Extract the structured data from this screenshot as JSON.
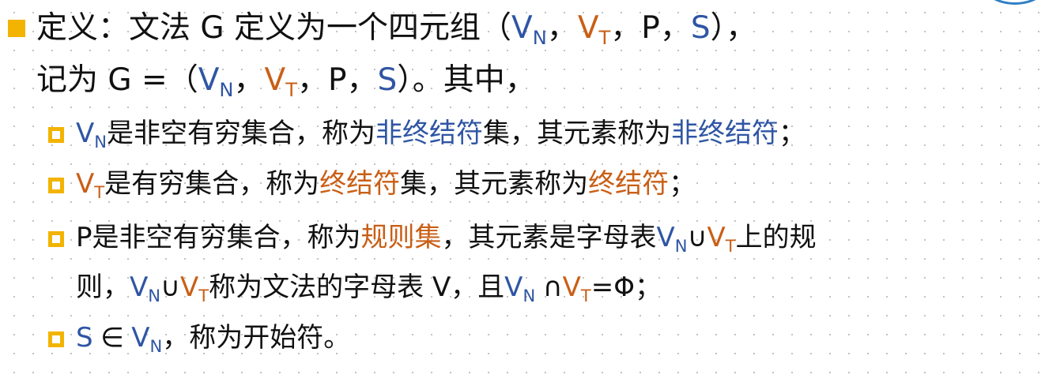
{
  "colors": {
    "background": "#ffffff",
    "bullet": "#f2b400",
    "text": "#111111",
    "blue": "#2f55a4",
    "orange": "#c95f16",
    "circle": "#2f7fc4"
  },
  "icons": {
    "main_bullet": "filled-square",
    "sub_bullet": "hollow-square",
    "corner_shape": "partial-circle"
  },
  "lines": {
    "line1": {
      "definition_label": "定义：文法 G 定义为一个四元组（",
      "vn": "V",
      "vn_sub": "N",
      "comma1": "，",
      "vt": "V",
      "vt_sub": "T",
      "comma2": "，",
      "p": "P",
      "comma3": "，",
      "s": "S",
      "close": "），"
    },
    "line2": {
      "prefix": "记为 G =（",
      "vn": "V",
      "vn_sub": "N",
      "comma1": "，",
      "vt": "V",
      "vt_sub": "T",
      "comma2": "，",
      "p": "P",
      "comma3": "，",
      "s": "S",
      "suffix": "）。其中，"
    },
    "line3": {
      "v": "V",
      "sub": "N",
      "text1": "是非空有穷集合，称为",
      "highlight1": "非终结符",
      "text2": "集，其元素称为",
      "highlight2": "非终结符",
      "text3": "；"
    },
    "line4": {
      "v": "V",
      "sub": "T",
      "text1": "是有穷集合，称为",
      "highlight1": "终结符",
      "text2": "集，其元素称为",
      "highlight2": "终结符",
      "text3": "；"
    },
    "line5": {
      "p": "P",
      "text1": "是非空有穷集合，称为",
      "highlight": "规则集",
      "text2": "，其元素是字母表",
      "vn": "V",
      "vn_sub": "N",
      "union": "∪",
      "vt": "V",
      "vt_sub": "T",
      "text3": "上的规"
    },
    "line6": {
      "text1": "则，",
      "vn": "V",
      "vn_sub": "N",
      "union": "∪",
      "vt": "V",
      "vt_sub": "T",
      "text2": "称为文法的字母表 V，且",
      "vn2": "V",
      "vn2_sub": "N",
      "intersect": "∩",
      "vt2": "V",
      "vt2_sub": "T",
      "text3": "=Φ；"
    },
    "line7": {
      "s": "S",
      "in": "∈",
      "vn": "V",
      "vn_sub": "N",
      "text": "，称为开始符。"
    }
  }
}
